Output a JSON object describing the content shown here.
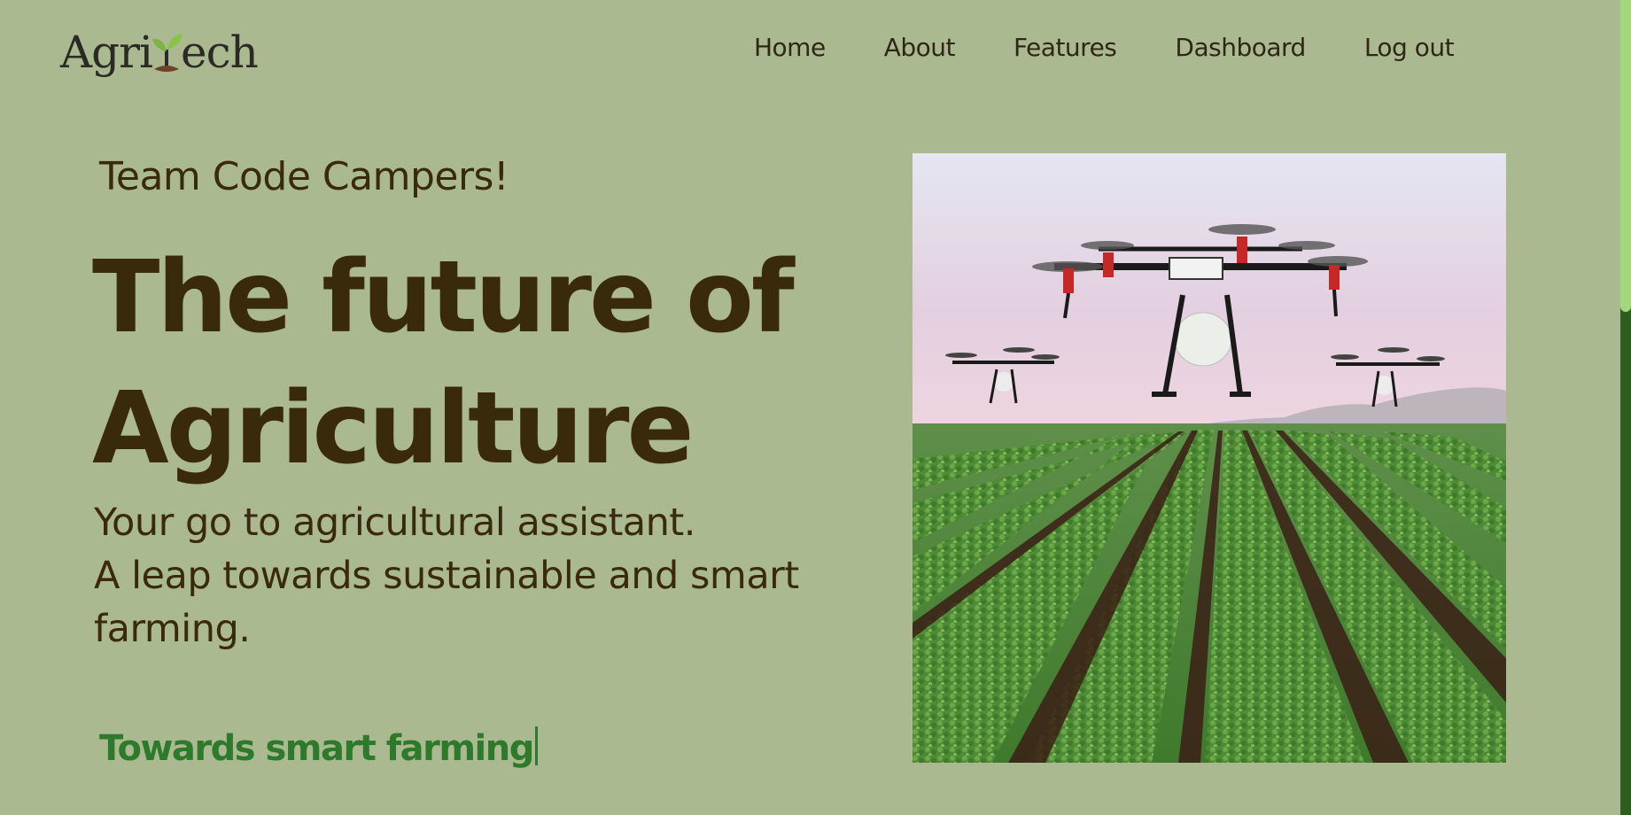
{
  "brand": {
    "name_prefix": "Agri",
    "name_suffix": "ech"
  },
  "nav": {
    "items": [
      {
        "label": "Home"
      },
      {
        "label": "About"
      },
      {
        "label": "Features"
      },
      {
        "label": "Dashboard"
      },
      {
        "label": "Log out"
      }
    ]
  },
  "hero": {
    "team": "Team Code Campers!",
    "headline_line1": "The future of",
    "headline_line2": "Agriculture",
    "sub_line1": "Your go to agricultural assistant.",
    "sub_line2": "A leap towards sustainable and smart farming.",
    "tagline": "Towards smart farming"
  },
  "colors": {
    "background": "#abb991",
    "text": "#3a2a0c",
    "accent_green": "#2e7a2c",
    "scrollbar_track": "#2b5e20",
    "scrollbar_thumb": "#a6d67c"
  },
  "icons": {
    "logo_mark": "sprout-icon",
    "hero_image": "drones-over-crop-field"
  }
}
